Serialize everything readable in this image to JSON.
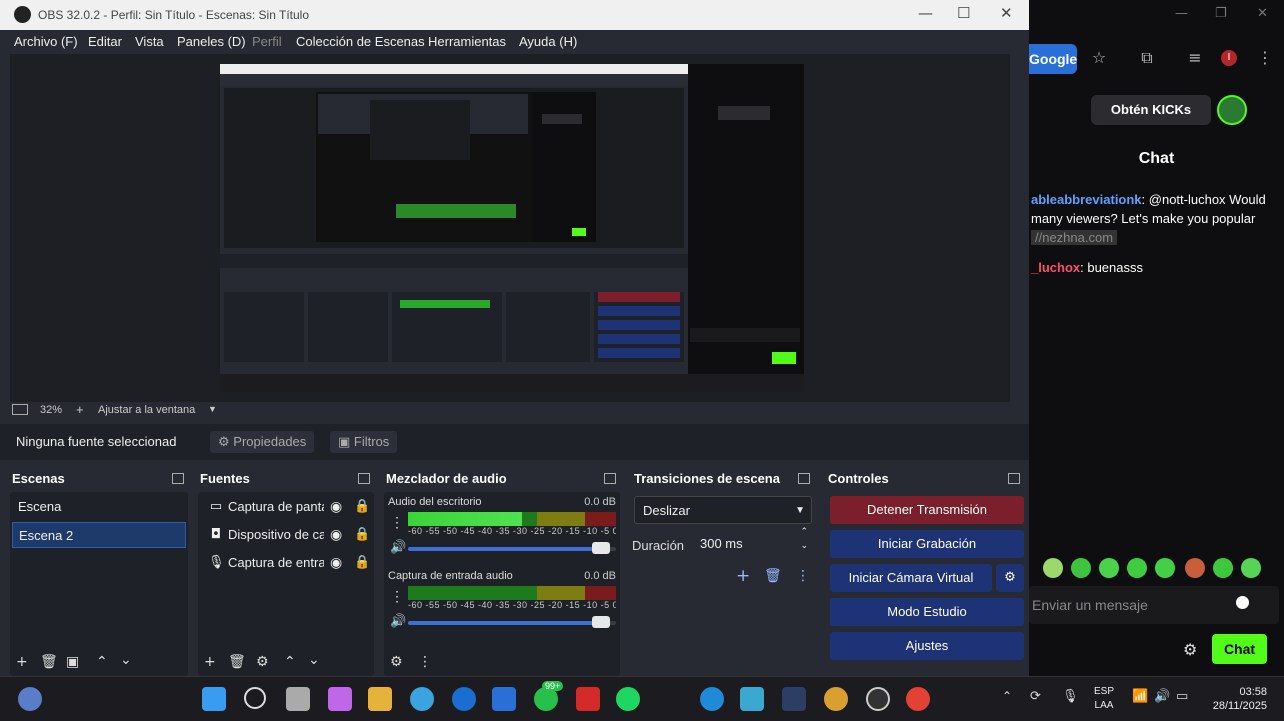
{
  "browser": {
    "google_chip": "Google",
    "kicks_button": "Obtén KICKs",
    "chat_title": "Chat",
    "messages": [
      {
        "user": "ableabbreviationk",
        "text": ": @nott-luchox Would many viewers? Let's make you popular",
        "link": "//nezhna.com"
      },
      {
        "user": "_luchox",
        "text": ": buenasss"
      }
    ],
    "chat_input_placeholder": "Enviar un mensaje",
    "chat_send": "Chat",
    "accent": "#53fc18"
  },
  "obs": {
    "title": "OBS 32.0.2 - Perfil: Sin Título - Escenas: Sin Título",
    "menu": [
      "Archivo (F)",
      "Editar",
      "Vista",
      "Paneles (D)",
      "Perfil",
      "Colección de Escenas",
      "Herramientas",
      "Ayuda (H)"
    ],
    "zoom": "32%",
    "fit_label": "Ajustar a la ventana",
    "no_source": "Ninguna fuente seleccionad",
    "properties": "Propiedades",
    "filters": "Filtros",
    "scenes_title": "Escenas",
    "scenes": [
      "Escena",
      "Escena 2"
    ],
    "sources_title": "Fuentes",
    "sources": [
      {
        "name": "Captura de pantalla",
        "icon": "monitor-icon"
      },
      {
        "name": "Dispositivo de captura",
        "icon": "camera-icon"
      },
      {
        "name": "Captura de entrada",
        "icon": "mic-icon"
      }
    ],
    "mixer_title": "Mezclador de audio",
    "mixer": [
      {
        "name": "Audio del escritorio",
        "db": "0.0 dB",
        "level": 0.55,
        "volume": 0.93
      },
      {
        "name": "Captura de entrada audio",
        "db": "0.0 dB",
        "level": 0.0,
        "volume": 0.93
      }
    ],
    "meter_scale": "-60 -55 -50 -45 -40 -35 -30 -25 -20 -15 -10 -5 0",
    "transitions_title": "Transiciones de escena",
    "transition": "Deslizar",
    "duration_label": "Duración",
    "duration_value": "300 ms",
    "controls_title": "Controles",
    "controls": [
      "Detener Transmisión",
      "Iniciar Grabación",
      "Iniciar Cámara Virtual",
      "Modo Estudio",
      "Ajustes"
    ]
  },
  "taskbar": {
    "lang": "ESP",
    "lang2": "LAA",
    "time": "03:58",
    "date": "28/11/2025",
    "badge": "99+"
  }
}
